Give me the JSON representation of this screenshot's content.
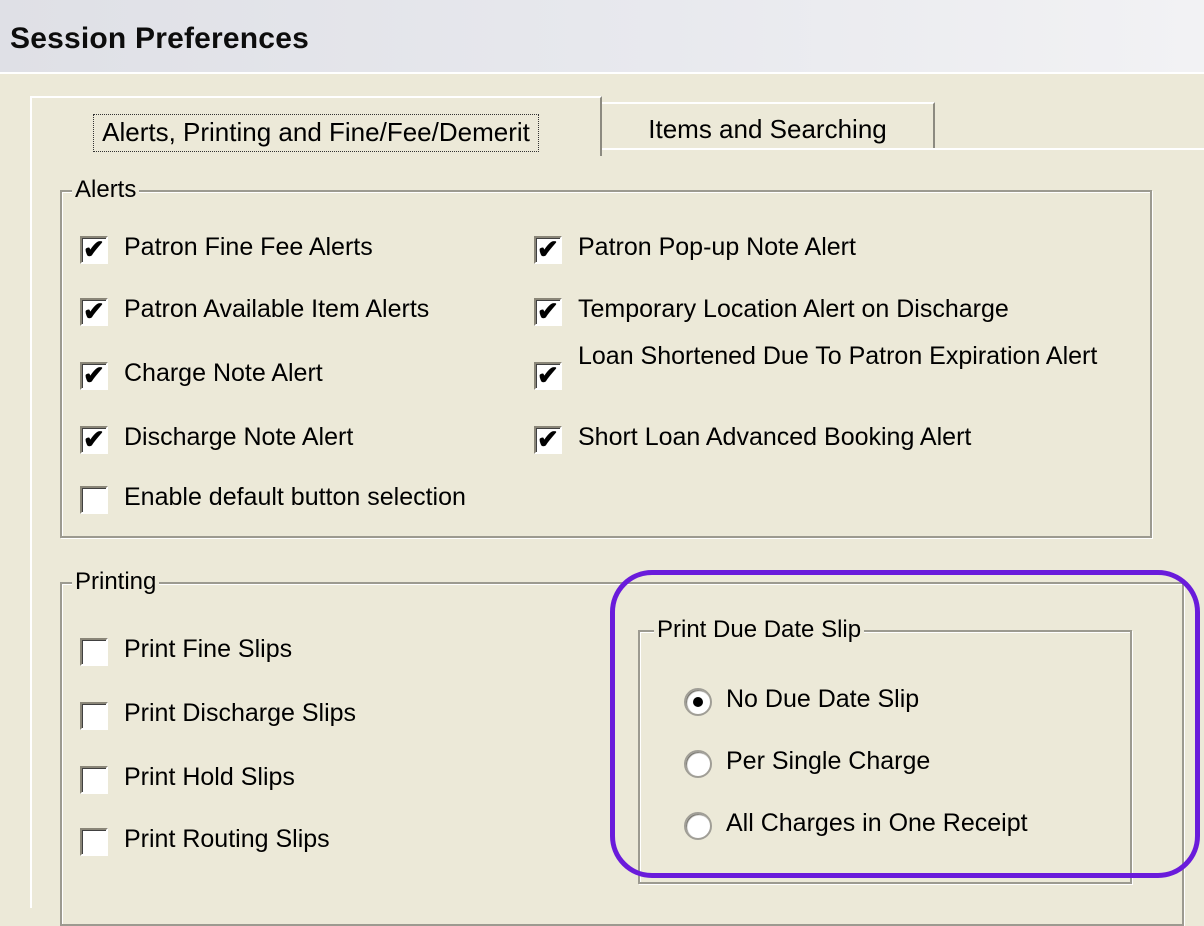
{
  "window": {
    "title": "Session Preferences"
  },
  "tabs": [
    {
      "label": "Alerts, Printing and Fine/Fee/Demerit",
      "active": true
    },
    {
      "label": "Items and Searching",
      "active": false
    }
  ],
  "alerts": {
    "legend": "Alerts",
    "items": [
      {
        "label": "Patron Fine Fee Alerts",
        "checked": true
      },
      {
        "label": "Patron Available Item Alerts",
        "checked": true
      },
      {
        "label": "Charge Note Alert",
        "checked": true
      },
      {
        "label": "Discharge Note Alert",
        "checked": true
      },
      {
        "label": "Enable default button selection",
        "checked": false
      },
      {
        "label": "Patron Pop-up Note Alert",
        "checked": true
      },
      {
        "label": "Temporary Location Alert on Discharge",
        "checked": true
      },
      {
        "label": "Loan Shortened Due To Patron Expiration Alert",
        "checked": true
      },
      {
        "label": "Short Loan Advanced Booking Alert",
        "checked": true
      }
    ]
  },
  "printing": {
    "legend": "Printing",
    "items": [
      {
        "label": "Print Fine Slips",
        "checked": false
      },
      {
        "label": "Print Discharge Slips",
        "checked": false
      },
      {
        "label": "Print Hold Slips",
        "checked": false
      },
      {
        "label": "Print Routing Slips",
        "checked": false
      }
    ]
  },
  "due_date_slip": {
    "legend": "Print Due Date Slip",
    "options": [
      {
        "label": "No Due Date Slip",
        "selected": true
      },
      {
        "label": "Per Single Charge",
        "selected": false
      },
      {
        "label": "All Charges in One Receipt",
        "selected": false
      }
    ]
  },
  "colors": {
    "highlight_outline": "#6a1bdb",
    "dialog_bg": "#ece9d8"
  },
  "icons": {
    "checked_mark": "✔"
  }
}
